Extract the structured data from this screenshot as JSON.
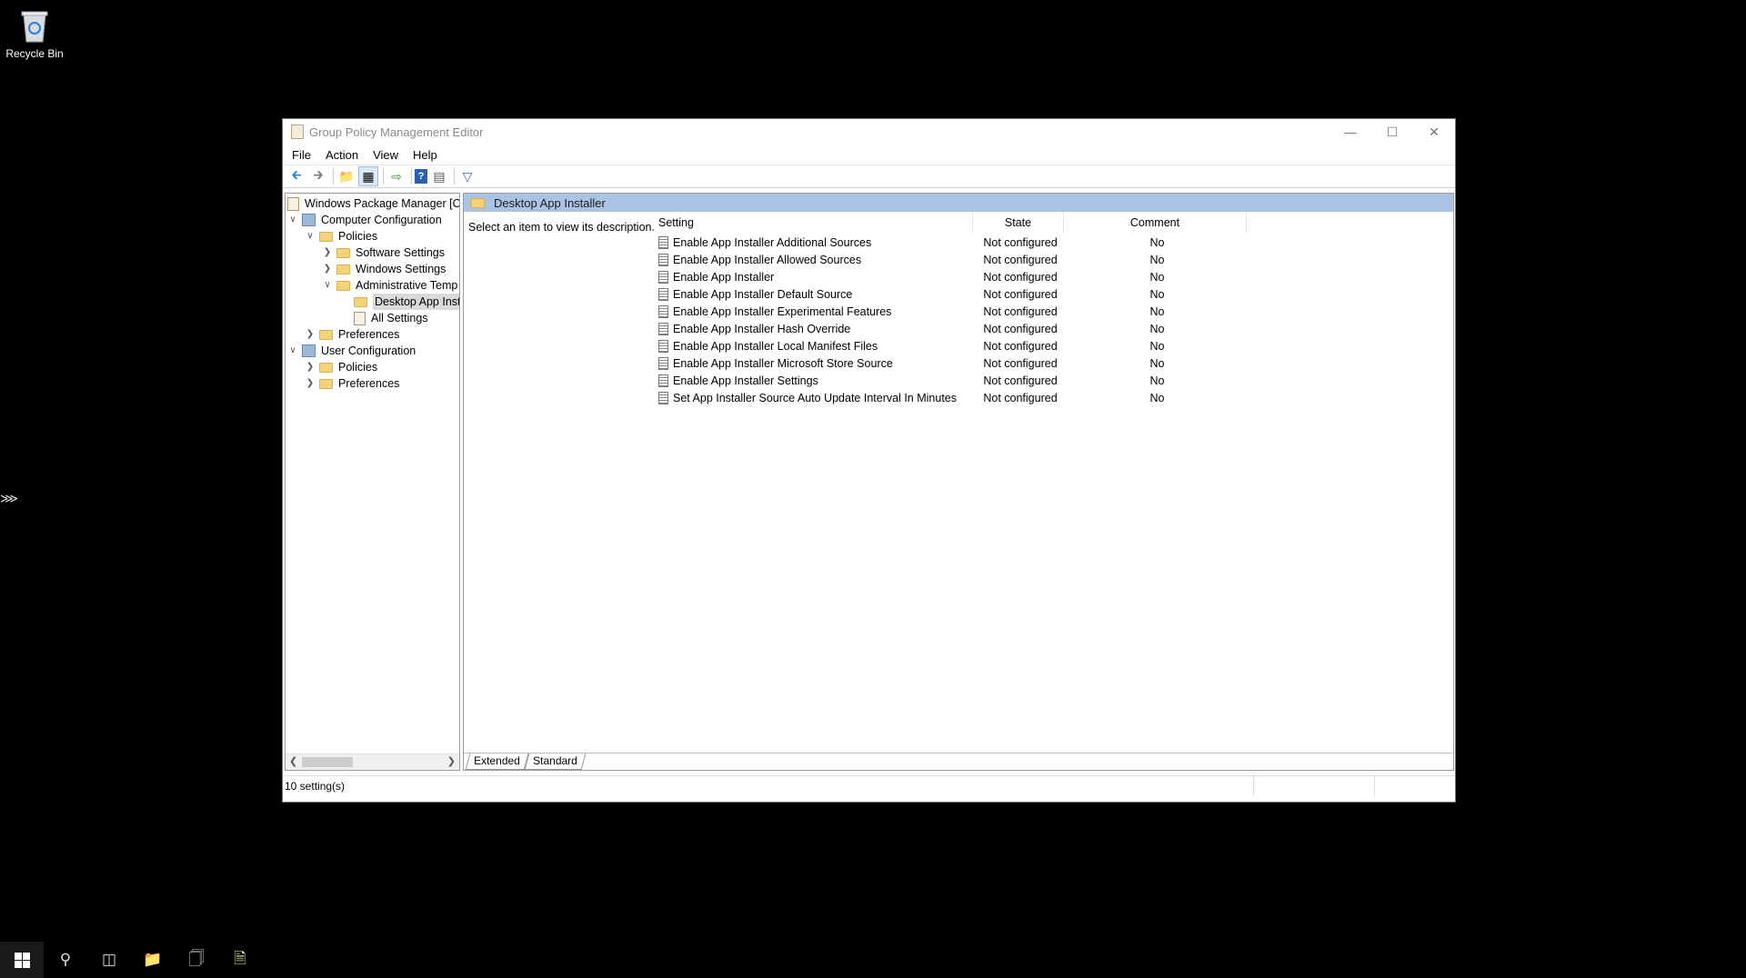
{
  "desktop": {
    "recycle_bin_label": "Recycle Bin"
  },
  "window": {
    "title": "Group Policy Management Editor",
    "menu": [
      "File",
      "Action",
      "View",
      "Help"
    ]
  },
  "tree": {
    "root": "Windows Package Manager [CN",
    "computer_configuration": "Computer Configuration",
    "cc_policies": "Policies",
    "software_settings": "Software Settings",
    "windows_settings": "Windows Settings",
    "administrative_templates": "Administrative Temp",
    "desktop_app_installer": "Desktop App Inst",
    "all_settings": "All Settings",
    "cc_preferences": "Preferences",
    "user_configuration": "User Configuration",
    "uc_policies": "Policies",
    "uc_preferences": "Preferences"
  },
  "content": {
    "header": "Desktop App Installer",
    "description": "Select an item to view its description.",
    "columns": {
      "setting": "Setting",
      "state": "State",
      "comment": "Comment"
    },
    "rows": [
      {
        "setting": "Enable App Installer Additional Sources",
        "state": "Not configured",
        "comment": "No"
      },
      {
        "setting": "Enable App Installer Allowed Sources",
        "state": "Not configured",
        "comment": "No"
      },
      {
        "setting": "Enable App Installer",
        "state": "Not configured",
        "comment": "No"
      },
      {
        "setting": "Enable App Installer Default Source",
        "state": "Not configured",
        "comment": "No"
      },
      {
        "setting": "Enable App Installer Experimental Features",
        "state": "Not configured",
        "comment": "No"
      },
      {
        "setting": "Enable App Installer Hash Override",
        "state": "Not configured",
        "comment": "No"
      },
      {
        "setting": "Enable App Installer Local Manifest Files",
        "state": "Not configured",
        "comment": "No"
      },
      {
        "setting": "Enable App Installer Microsoft Store Source",
        "state": "Not configured",
        "comment": "No"
      },
      {
        "setting": "Enable App Installer Settings",
        "state": "Not configured",
        "comment": "No"
      },
      {
        "setting": "Set App Installer Source Auto Update Interval In Minutes",
        "state": "Not configured",
        "comment": "No"
      }
    ],
    "tabs": [
      "Extended",
      "Standard"
    ]
  },
  "status": {
    "text": "10 setting(s)"
  },
  "colors": {
    "header_bg": "#a9c4e3",
    "folder": "#f3d27a",
    "desktop": "#000000"
  }
}
